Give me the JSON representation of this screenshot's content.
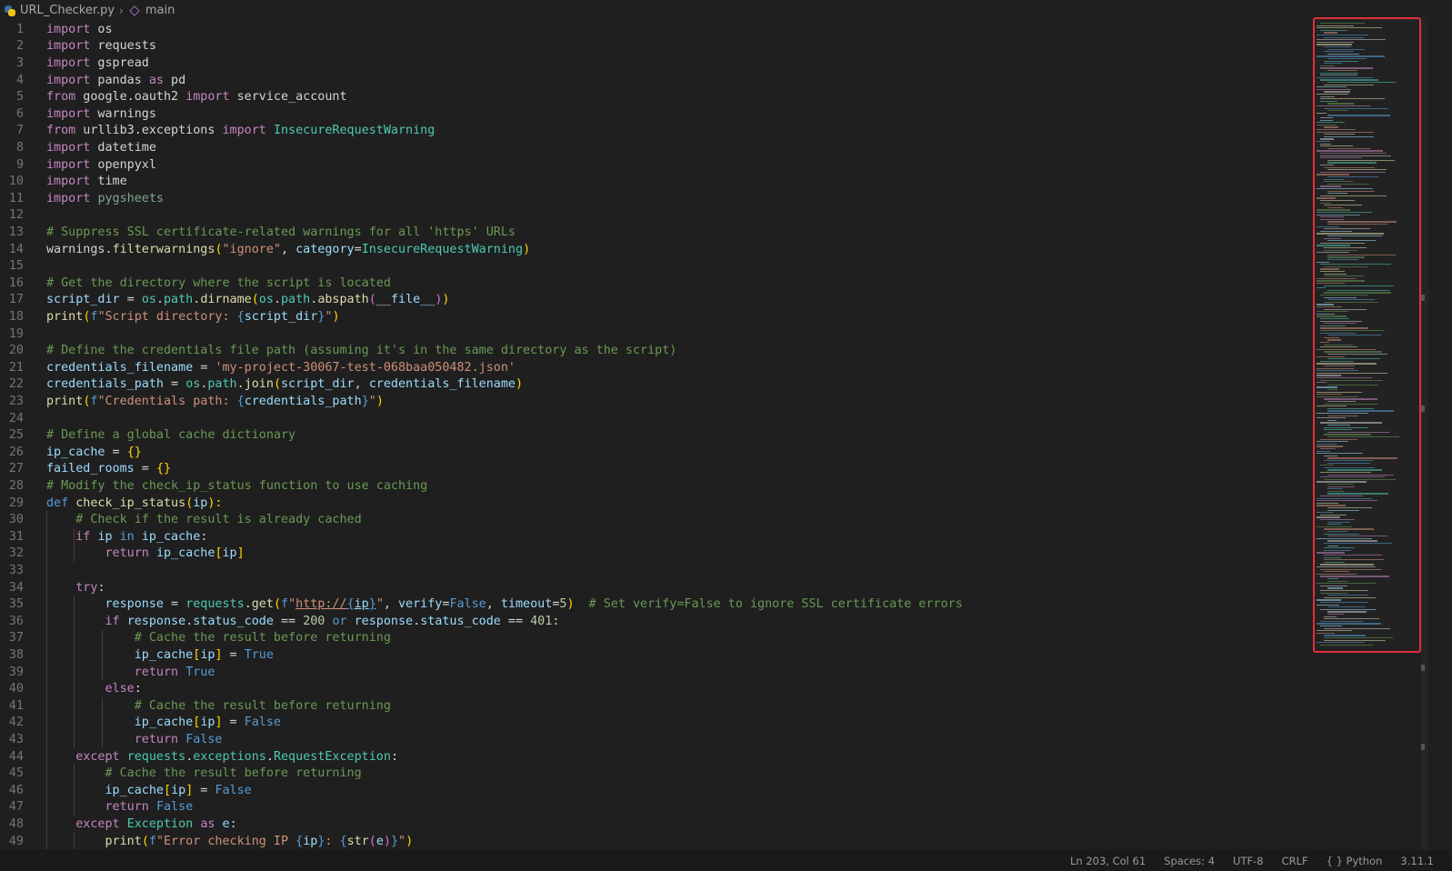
{
  "breadcrumb": {
    "file": "URL_Checker.py",
    "symbol": "main"
  },
  "status_bar": {
    "items": [
      "Ln 203, Col 61",
      "Spaces: 4",
      "UTF-8",
      "CRLF",
      "{ } Python",
      "3.11.1"
    ]
  },
  "colors": {
    "accent_highlight": "#e0303a",
    "comment": "#6a9955",
    "keyword": "#569cd6"
  },
  "lines": [
    [
      [
        "kc",
        "import"
      ],
      [
        "p",
        " os"
      ]
    ],
    [
      [
        "kc",
        "import"
      ],
      [
        "p",
        " requests"
      ]
    ],
    [
      [
        "kc",
        "import"
      ],
      [
        "p",
        " gspread"
      ]
    ],
    [
      [
        "kc",
        "import"
      ],
      [
        "p",
        " pandas "
      ],
      [
        "kc",
        "as"
      ],
      [
        "p",
        " pd"
      ]
    ],
    [
      [
        "kc",
        "from"
      ],
      [
        "p",
        " google.oauth2 "
      ],
      [
        "kc",
        "import"
      ],
      [
        "p",
        " service_account"
      ]
    ],
    [
      [
        "kc",
        "import"
      ],
      [
        "p",
        " warnings"
      ]
    ],
    [
      [
        "kc",
        "from"
      ],
      [
        "p",
        " urllib3.exceptions "
      ],
      [
        "kc",
        "import"
      ],
      [
        "p",
        " "
      ],
      [
        "m",
        "InsecureRequestWarning"
      ]
    ],
    [
      [
        "kc",
        "import"
      ],
      [
        "p",
        " datetime"
      ]
    ],
    [
      [
        "kc",
        "import"
      ],
      [
        "p",
        " openpyxl"
      ]
    ],
    [
      [
        "kc",
        "import"
      ],
      [
        "p",
        " time"
      ]
    ],
    [
      [
        "kc",
        "import"
      ],
      [
        "p",
        " "
      ],
      [
        "dim",
        "pygsheets"
      ]
    ],
    [],
    [
      [
        "c",
        "# Suppress SSL certificate-related warnings for all 'https' URLs"
      ]
    ],
    [
      [
        "p",
        "warnings."
      ],
      [
        "f",
        "filterwarnings"
      ],
      [
        "b1",
        "("
      ],
      [
        "s",
        "\"ignore\""
      ],
      [
        "p",
        ", "
      ],
      [
        "v",
        "category"
      ],
      [
        "p",
        "="
      ],
      [
        "m",
        "InsecureRequestWarning"
      ],
      [
        "b1",
        ")"
      ]
    ],
    [],
    [
      [
        "c",
        "# Get the directory where the script is located"
      ]
    ],
    [
      [
        "v",
        "script_dir"
      ],
      [
        "p",
        " = "
      ],
      [
        "m",
        "os"
      ],
      [
        "p",
        "."
      ],
      [
        "m",
        "path"
      ],
      [
        "p",
        "."
      ],
      [
        "f",
        "dirname"
      ],
      [
        "b1",
        "("
      ],
      [
        "m",
        "os"
      ],
      [
        "p",
        "."
      ],
      [
        "m",
        "path"
      ],
      [
        "p",
        "."
      ],
      [
        "f",
        "abspath"
      ],
      [
        "b2",
        "("
      ],
      [
        "v",
        "__file__"
      ],
      [
        "b2",
        ")"
      ],
      [
        "b1",
        ")"
      ]
    ],
    [
      [
        "f",
        "print"
      ],
      [
        "b1",
        "("
      ],
      [
        "k",
        "f"
      ],
      [
        "s",
        "\"Script directory: "
      ],
      [
        "k",
        "{"
      ],
      [
        "v",
        "script_dir"
      ],
      [
        "k",
        "}"
      ],
      [
        "s",
        "\""
      ],
      [
        "b1",
        ")"
      ]
    ],
    [],
    [
      [
        "c",
        "# Define the credentials file path (assuming it's in the same directory as the script)"
      ]
    ],
    [
      [
        "v",
        "credentials_filename"
      ],
      [
        "p",
        " = "
      ],
      [
        "s",
        "'my-project-30067-test-068baa050482.json'"
      ]
    ],
    [
      [
        "v",
        "credentials_path"
      ],
      [
        "p",
        " = "
      ],
      [
        "m",
        "os"
      ],
      [
        "p",
        "."
      ],
      [
        "m",
        "path"
      ],
      [
        "p",
        "."
      ],
      [
        "f",
        "join"
      ],
      [
        "b1",
        "("
      ],
      [
        "v",
        "script_dir"
      ],
      [
        "p",
        ", "
      ],
      [
        "v",
        "credentials_filename"
      ],
      [
        "b1",
        ")"
      ]
    ],
    [
      [
        "f",
        "print"
      ],
      [
        "b1",
        "("
      ],
      [
        "k",
        "f"
      ],
      [
        "s",
        "\"Credentials path: "
      ],
      [
        "k",
        "{"
      ],
      [
        "v",
        "credentials_path"
      ],
      [
        "k",
        "}"
      ],
      [
        "s",
        "\""
      ],
      [
        "b1",
        ")"
      ]
    ],
    [],
    [
      [
        "c",
        "# Define a global cache dictionary"
      ]
    ],
    [
      [
        "v",
        "ip_cache"
      ],
      [
        "p",
        " = "
      ],
      [
        "b1",
        "{}"
      ]
    ],
    [
      [
        "v",
        "failed_rooms"
      ],
      [
        "p",
        " = "
      ],
      [
        "b1",
        "{}"
      ]
    ],
    [
      [
        "c",
        "# Modify the check_ip_status function to use caching"
      ]
    ],
    [
      [
        "k",
        "def"
      ],
      [
        "p",
        " "
      ],
      [
        "f",
        "check_ip_status"
      ],
      [
        "b1",
        "("
      ],
      [
        "v",
        "ip"
      ],
      [
        "b1",
        "):"
      ]
    ],
    [
      [
        "p",
        "    "
      ],
      [
        "c",
        "# Check if the result is already cached"
      ]
    ],
    [
      [
        "p",
        "    "
      ],
      [
        "kc",
        "if"
      ],
      [
        "p",
        " "
      ],
      [
        "v",
        "ip"
      ],
      [
        "p",
        " "
      ],
      [
        "k",
        "in"
      ],
      [
        "p",
        " "
      ],
      [
        "v",
        "ip_cache"
      ],
      [
        "p",
        ":"
      ]
    ],
    [
      [
        "p",
        "        "
      ],
      [
        "kc",
        "return"
      ],
      [
        "p",
        " "
      ],
      [
        "v",
        "ip_cache"
      ],
      [
        "b1",
        "["
      ],
      [
        "v",
        "ip"
      ],
      [
        "b1",
        "]"
      ]
    ],
    [],
    [
      [
        "p",
        "    "
      ],
      [
        "kc",
        "try"
      ],
      [
        "p",
        ":"
      ]
    ],
    [
      [
        "p",
        "        "
      ],
      [
        "v",
        "response"
      ],
      [
        "p",
        " = "
      ],
      [
        "m",
        "requests"
      ],
      [
        "p",
        "."
      ],
      [
        "f",
        "get"
      ],
      [
        "b1",
        "("
      ],
      [
        "k",
        "f"
      ],
      [
        "s",
        "\""
      ],
      [
        "s u",
        "http://"
      ],
      [
        "k u",
        "{"
      ],
      [
        "v u",
        "ip"
      ],
      [
        "k u",
        "}"
      ],
      [
        "s",
        "\""
      ],
      [
        "p",
        ", "
      ],
      [
        "v",
        "verify"
      ],
      [
        "p",
        "="
      ],
      [
        "k",
        "False"
      ],
      [
        "p",
        ", "
      ],
      [
        "v",
        "timeout"
      ],
      [
        "p",
        "="
      ],
      [
        "n",
        "5"
      ],
      [
        "b1",
        ")"
      ],
      [
        "p",
        "  "
      ],
      [
        "c",
        "# Set verify=False to ignore SSL certificate errors"
      ]
    ],
    [
      [
        "p",
        "        "
      ],
      [
        "kc",
        "if"
      ],
      [
        "p",
        " "
      ],
      [
        "v",
        "response"
      ],
      [
        "p",
        "."
      ],
      [
        "v",
        "status_code"
      ],
      [
        "p",
        " == "
      ],
      [
        "n",
        "200"
      ],
      [
        "p",
        " "
      ],
      [
        "k",
        "or"
      ],
      [
        "p",
        " "
      ],
      [
        "v",
        "response"
      ],
      [
        "p",
        "."
      ],
      [
        "v",
        "status_code"
      ],
      [
        "p",
        " == "
      ],
      [
        "n",
        "401"
      ],
      [
        "p",
        ":"
      ]
    ],
    [
      [
        "p",
        "            "
      ],
      [
        "c",
        "# Cache the result before returning"
      ]
    ],
    [
      [
        "p",
        "            "
      ],
      [
        "v",
        "ip_cache"
      ],
      [
        "b1",
        "["
      ],
      [
        "v",
        "ip"
      ],
      [
        "b1",
        "]"
      ],
      [
        "p",
        " = "
      ],
      [
        "k",
        "True"
      ]
    ],
    [
      [
        "p",
        "            "
      ],
      [
        "kc",
        "return"
      ],
      [
        "p",
        " "
      ],
      [
        "k",
        "True"
      ]
    ],
    [
      [
        "p",
        "        "
      ],
      [
        "kc",
        "else"
      ],
      [
        "p",
        ":"
      ]
    ],
    [
      [
        "p",
        "            "
      ],
      [
        "c",
        "# Cache the result before returning"
      ]
    ],
    [
      [
        "p",
        "            "
      ],
      [
        "v",
        "ip_cache"
      ],
      [
        "b1",
        "["
      ],
      [
        "v",
        "ip"
      ],
      [
        "b1",
        "]"
      ],
      [
        "p",
        " = "
      ],
      [
        "k",
        "False"
      ]
    ],
    [
      [
        "p",
        "            "
      ],
      [
        "kc",
        "return"
      ],
      [
        "p",
        " "
      ],
      [
        "k",
        "False"
      ]
    ],
    [
      [
        "p",
        "    "
      ],
      [
        "kc",
        "except"
      ],
      [
        "p",
        " "
      ],
      [
        "m",
        "requests"
      ],
      [
        "p",
        "."
      ],
      [
        "m",
        "exceptions"
      ],
      [
        "p",
        "."
      ],
      [
        "m",
        "RequestException"
      ],
      [
        "p",
        ":"
      ]
    ],
    [
      [
        "p",
        "        "
      ],
      [
        "c",
        "# Cache the result before returning"
      ]
    ],
    [
      [
        "p",
        "        "
      ],
      [
        "v",
        "ip_cache"
      ],
      [
        "b1",
        "["
      ],
      [
        "v",
        "ip"
      ],
      [
        "b1",
        "]"
      ],
      [
        "p",
        " = "
      ],
      [
        "k",
        "False"
      ]
    ],
    [
      [
        "p",
        "        "
      ],
      [
        "kc",
        "return"
      ],
      [
        "p",
        " "
      ],
      [
        "k",
        "False"
      ]
    ],
    [
      [
        "p",
        "    "
      ],
      [
        "kc",
        "except"
      ],
      [
        "p",
        " "
      ],
      [
        "m",
        "Exception"
      ],
      [
        "p",
        " "
      ],
      [
        "kc",
        "as"
      ],
      [
        "p",
        " "
      ],
      [
        "v",
        "e"
      ],
      [
        "p",
        ":"
      ]
    ],
    [
      [
        "p",
        "        "
      ],
      [
        "f",
        "print"
      ],
      [
        "b1",
        "("
      ],
      [
        "k",
        "f"
      ],
      [
        "s",
        "\"Error checking IP "
      ],
      [
        "k",
        "{"
      ],
      [
        "v",
        "ip"
      ],
      [
        "k",
        "}"
      ],
      [
        "s",
        ": "
      ],
      [
        "k",
        "{"
      ],
      [
        "f",
        "str"
      ],
      [
        "b2",
        "("
      ],
      [
        "v",
        "e"
      ],
      [
        "b2",
        ")"
      ],
      [
        "k",
        "}"
      ],
      [
        "s",
        "\""
      ],
      [
        "b1",
        ")"
      ]
    ]
  ]
}
